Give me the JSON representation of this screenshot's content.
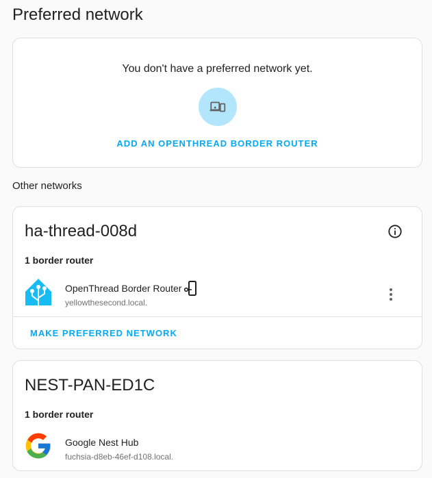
{
  "page": {
    "title": "Preferred network"
  },
  "preferred": {
    "empty_message": "You don't have a preferred network yet.",
    "icon": "router-devices-icon",
    "add_button_label": "ADD AN OPENTHREAD BORDER ROUTER"
  },
  "other_networks_label": "Other networks",
  "networks": [
    {
      "name": "ha-thread-008d",
      "info_icon": "information-outline-icon",
      "router_count": "1 border router",
      "routers": [
        {
          "name": "OpenThread Border Router",
          "host": "yellowthesecond.local.",
          "logo": "home-assistant-logo",
          "badge_icon": "border-router-icon",
          "menu_icon": "dots-vertical-icon"
        }
      ],
      "action_label": "MAKE PREFERRED NETWORK"
    },
    {
      "name": "NEST-PAN-ED1C",
      "router_count": "1 border router",
      "routers": [
        {
          "name": "Google Nest Hub",
          "host": "fuchsia-d8eb-46ef-d108.local.",
          "logo": "google-logo"
        }
      ]
    }
  ],
  "colors": {
    "accent": "#03a9f4",
    "icon_bg": "#b3e5fc",
    "ha_blue": "#18bcf2",
    "secondary_text": "#727272"
  }
}
